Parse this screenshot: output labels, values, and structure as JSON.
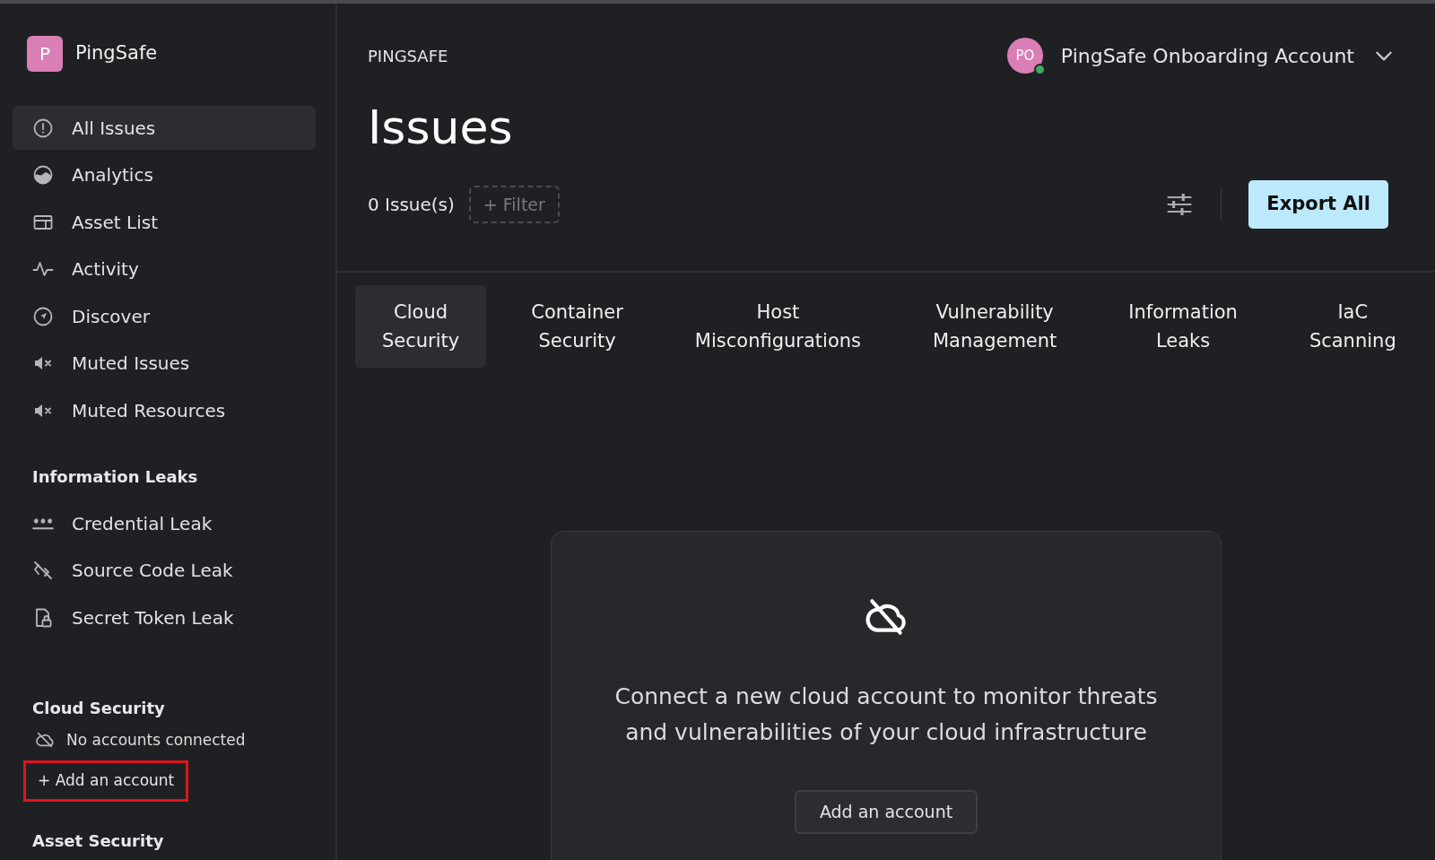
{
  "app": {
    "logo_letter": "P",
    "name": "PingSafe"
  },
  "nav": [
    {
      "label": "All Issues",
      "selected": true
    },
    {
      "label": "Analytics",
      "selected": false
    },
    {
      "label": "Asset List",
      "selected": false
    },
    {
      "label": "Activity",
      "selected": false
    },
    {
      "label": "Discover",
      "selected": false
    },
    {
      "label": "Muted Issues",
      "selected": false
    },
    {
      "label": "Muted Resources",
      "selected": false
    }
  ],
  "sections": [
    {
      "title": "Information Leaks",
      "items": [
        {
          "label": "Credential Leak",
          "selected": false
        },
        {
          "label": "Source Code Leak",
          "selected": false
        },
        {
          "label": "Secret Token Leak",
          "selected": false
        }
      ]
    },
    {
      "title": "Cloud Security",
      "status": "No accounts connected",
      "link": {
        "label": "+ Add an account",
        "highlighted": true
      }
    },
    {
      "title": "Asset Security"
    }
  ],
  "header": {
    "breadcrumb": "PINGSAFE",
    "account": {
      "initials": "PO",
      "name": "PingSafe Onboarding Account",
      "online": true
    },
    "title": "Issues",
    "count": "0 Issue(s)",
    "filter": "+ Filter",
    "export": "Export All"
  },
  "tabs": [
    {
      "label": "Cloud Security",
      "selected": true
    },
    {
      "label": "Container Security",
      "selected": false
    },
    {
      "label": "Host Misconfigurations",
      "selected": false
    },
    {
      "label": "Vulnerability Management",
      "selected": false
    },
    {
      "label": "Information Leaks",
      "selected": false
    },
    {
      "label": "IaC Scanning",
      "selected": false
    }
  ],
  "empty_state": {
    "message": "Connect a new cloud account to monitor threats and vulnerabilities of your cloud infrastructure",
    "button": "Add an account"
  }
}
